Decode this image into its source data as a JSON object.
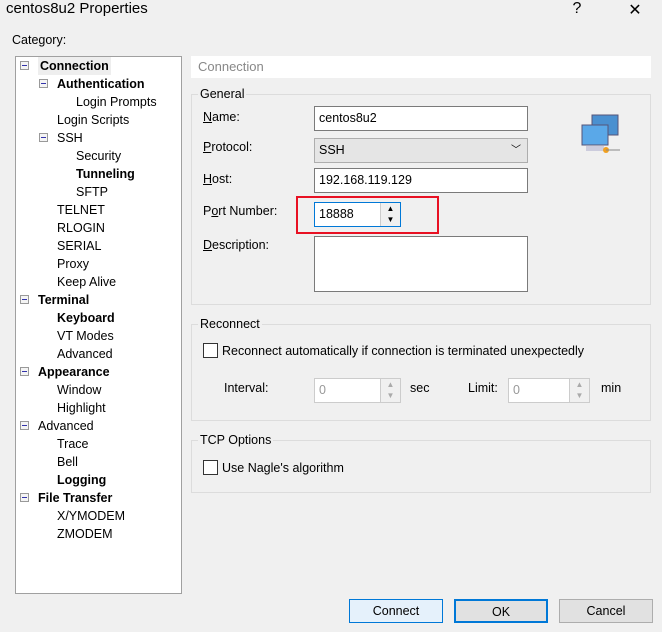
{
  "window": {
    "title": "centos8u2 Properties",
    "help": "?",
    "close": "✕"
  },
  "category_label": "Category:",
  "tree": [
    {
      "label": "Connection",
      "level": 0,
      "bold": true,
      "expanded": true,
      "selected": true
    },
    {
      "label": "Authentication",
      "level": 1,
      "bold": true,
      "expanded": true
    },
    {
      "label": "Login Prompts",
      "level": 2
    },
    {
      "label": "Login Scripts",
      "level": 1
    },
    {
      "label": "SSH",
      "level": 1,
      "expanded": true
    },
    {
      "label": "Security",
      "level": 2
    },
    {
      "label": "Tunneling",
      "level": 2,
      "bold": true
    },
    {
      "label": "SFTP",
      "level": 2
    },
    {
      "label": "TELNET",
      "level": 1
    },
    {
      "label": "RLOGIN",
      "level": 1
    },
    {
      "label": "SERIAL",
      "level": 1
    },
    {
      "label": "Proxy",
      "level": 1
    },
    {
      "label": "Keep Alive",
      "level": 1
    },
    {
      "label": "Terminal",
      "level": 0,
      "bold": true,
      "expanded": true
    },
    {
      "label": "Keyboard",
      "level": 1,
      "bold": true
    },
    {
      "label": "VT Modes",
      "level": 1
    },
    {
      "label": "Advanced",
      "level": 1
    },
    {
      "label": "Appearance",
      "level": 0,
      "bold": true,
      "expanded": true
    },
    {
      "label": "Window",
      "level": 1
    },
    {
      "label": "Highlight",
      "level": 1
    },
    {
      "label": "Advanced",
      "level": 0,
      "expanded": true
    },
    {
      "label": "Trace",
      "level": 1
    },
    {
      "label": "Bell",
      "level": 1
    },
    {
      "label": "Logging",
      "level": 1,
      "bold": true
    },
    {
      "label": "File Transfer",
      "level": 0,
      "bold": true,
      "expanded": true
    },
    {
      "label": "X/YMODEM",
      "level": 1
    },
    {
      "label": "ZMODEM",
      "level": 1
    }
  ],
  "panel_header": "Connection",
  "general": {
    "legend": "General",
    "name_label": "Name:",
    "name": "centos8u2",
    "protocol_label": "Protocol:",
    "protocol": "SSH",
    "host_label": "Host:",
    "host": "192.168.119.129",
    "port_label": "Port Number:",
    "port": "18888",
    "description_label": "Description:",
    "description": "",
    "highlight_color": "#e81123",
    "icon": "network-computers-icon"
  },
  "reconnect": {
    "legend": "Reconnect",
    "auto_label": "Reconnect automatically if connection is terminated unexpectedly",
    "auto_checked": false,
    "interval_label": "Interval:",
    "interval": "0",
    "interval_unit": "sec",
    "limit_label": "Limit:",
    "limit": "0",
    "limit_unit": "min"
  },
  "tcp": {
    "legend": "TCP Options",
    "nagle_label": "Use Nagle's algorithm",
    "nagle_checked": false
  },
  "buttons": {
    "connect": "Connect",
    "ok": "OK",
    "cancel": "Cancel"
  }
}
